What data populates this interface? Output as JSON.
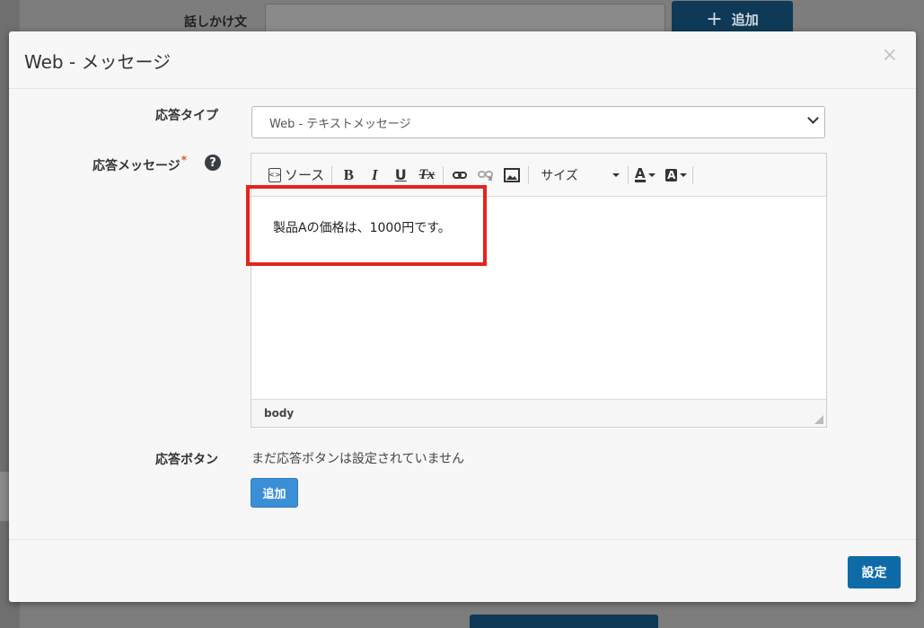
{
  "background": {
    "utterance_label": "話しかけ文",
    "add_button_label": "追加",
    "add_button_icon": "plus-icon"
  },
  "modal": {
    "title": "Web - メッセージ",
    "close_icon": "×",
    "response_type": {
      "label": "応答タイプ",
      "selected_value": "Web - テキストメッセージ"
    },
    "response_message": {
      "label": "応答メッセージ",
      "required_mark": "*",
      "help_icon": "?",
      "toolbar": {
        "source_label": "ソース",
        "bold": "B",
        "italic": "I",
        "underline": "U",
        "remove_format": "Tx",
        "size_label": "サイズ",
        "text_color": "A",
        "bg_color": "A"
      },
      "content": "製品Aの価格は、1000円です。",
      "path": "body"
    },
    "response_buttons": {
      "label": "応答ボタン",
      "empty_note": "まだ応答ボタンは設定されていません",
      "add_label": "追加"
    },
    "submit_label": "設定"
  },
  "colors": {
    "primary": "#0e6ba8",
    "add_button": "#3b8fd6",
    "highlight": "#e3231f"
  }
}
